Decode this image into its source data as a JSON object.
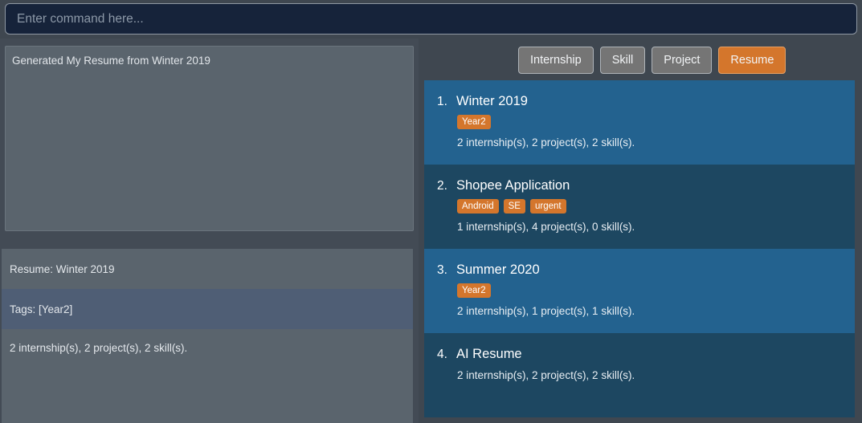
{
  "command": {
    "placeholder": "Enter command here...",
    "value": ""
  },
  "result": {
    "text": "Generated My Resume from Winter 2019"
  },
  "detail_panel": {
    "rows": [
      {
        "text": "Resume: Winter 2019"
      },
      {
        "text": "Tags: [Year2]"
      },
      {
        "text": "2 internship(s), 2 project(s), 2 skill(s)."
      }
    ]
  },
  "filters": {
    "buttons": [
      {
        "label": "Internship",
        "active": false
      },
      {
        "label": "Skill",
        "active": false
      },
      {
        "label": "Project",
        "active": false
      },
      {
        "label": "Resume",
        "active": true
      }
    ]
  },
  "entities": [
    {
      "index": "1.",
      "title": "Winter 2019",
      "tags": [
        "Year2"
      ],
      "counts": "2 internship(s), 2 project(s), 2 skill(s)."
    },
    {
      "index": "2.",
      "title": "Shopee Application",
      "tags": [
        "Android",
        "SE",
        "urgent"
      ],
      "counts": "1 internship(s), 4 project(s), 0 skill(s)."
    },
    {
      "index": "3.",
      "title": "Summer 2020",
      "tags": [
        "Year2"
      ],
      "counts": "2 internship(s), 1 project(s), 1 skill(s)."
    },
    {
      "index": "4.",
      "title": "AI Resume",
      "tags": [],
      "counts": "2 internship(s), 2 project(s), 2 skill(s)."
    }
  ],
  "colors": {
    "app_background": "#3f4750",
    "command_background": "#16233a",
    "panel_background": "#5a646d",
    "panel_highlight": "#4f5e75",
    "entity_primary": "#23628f",
    "entity_alt": "#1d4761",
    "accent_orange": "#d4762c",
    "button_gray": "#757575"
  }
}
